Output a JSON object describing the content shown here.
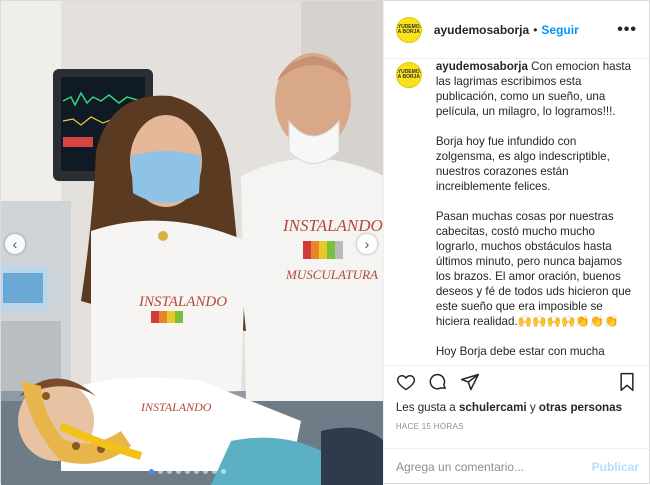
{
  "post": {
    "username": "ayudemosaborja",
    "separator": "•",
    "follow_label": "Seguir",
    "more_label": "•••",
    "avatar_text": "AYUDEMOS A BORJA",
    "caption": {
      "username": "ayudemosaborja",
      "text": " Con emocion hasta las lagrimas escribimos esta publicación, como un sueño, una película, un milagro, lo logramos!!!.\n\nBorja hoy fue infundido con zolgensma, es algo indescriptible, nuestros corazones están increiblemente felices.\n\nPasan muchas cosas por nuestras cabecitas, costó mucho mucho lograrlo, muchos obstáculos hasta últimos minuto, pero nunca bajamos los brazos. El amor oración, buenos deseos y fé de todos uds hicieron que este sueño que era imposible se hiciera realidad.🙌🙌🙌🙌👏👏👏\n\nHoy Borja debe estar con mucha"
    },
    "likes": {
      "prefix": "Les gusta a ",
      "user": "schulercami",
      "middle": " y ",
      "others": "otras personas"
    },
    "timestamp": "HACE 15 HORAS",
    "comment": {
      "placeholder": "Agrega un comentario...",
      "publish_label": "Publicar"
    },
    "photo": {
      "shirt_text_1": "INSTALANDO",
      "shirt_text_2": "MUSCULATURA",
      "carousel_count": 9,
      "carousel_active": 1
    },
    "colors": {
      "accent": "#0095f6",
      "publish_disabled": "#b2dffc",
      "avatar": "#f7e21c"
    },
    "icons": {
      "like": "heart-icon",
      "comment": "comment-icon",
      "share": "share-icon",
      "save": "bookmark-icon",
      "prev": "chevron-left-icon",
      "next": "chevron-right-icon"
    }
  }
}
